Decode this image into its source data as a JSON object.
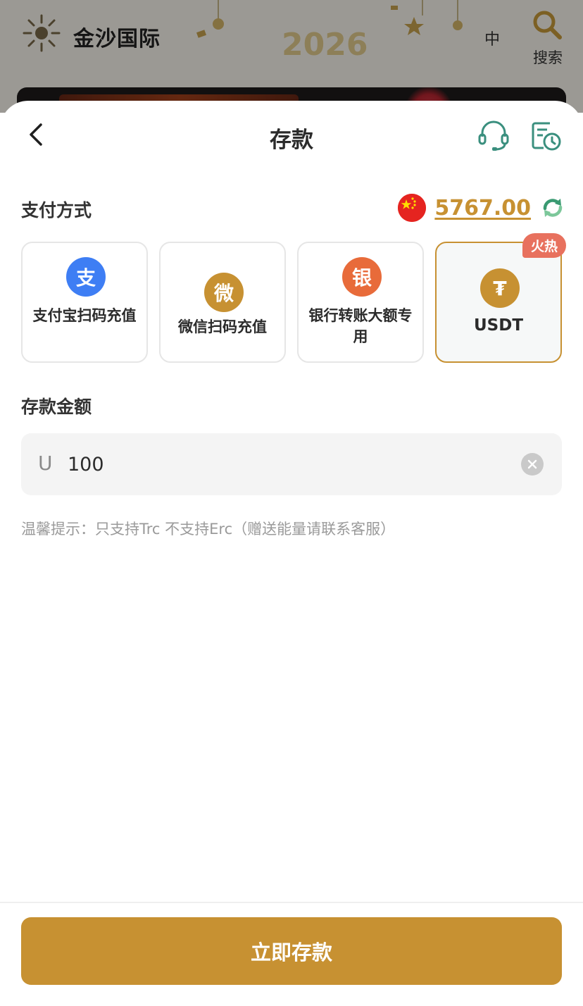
{
  "background": {
    "brand_name": "金沙国际",
    "deco_text": "2026",
    "lang_label": "中",
    "search_label": "搜索"
  },
  "sheet": {
    "title": "存款",
    "payment_section_label": "支付方式",
    "balance": "5767.00",
    "methods": [
      {
        "icon_char": "支",
        "label": "支付宝扫码充值",
        "color": "#3e7ef4",
        "selected": false
      },
      {
        "icon_char": "微",
        "label": "微信扫码充值",
        "color": "#c79132",
        "selected": false
      },
      {
        "icon_char": "银",
        "label": "银行转账大额专用",
        "color": "#e86b3a",
        "selected": false
      },
      {
        "icon_char": "₮",
        "label": "USDT",
        "color": "#c79132",
        "selected": true,
        "badge": "火热"
      }
    ],
    "amount_section_label": "存款金额",
    "amount_prefix": "U",
    "amount_value": "100",
    "hint": "温馨提示：只支持Trc 不支持Erc（赠送能量请联系客服）",
    "submit_label": "立即存款"
  },
  "colors": {
    "accent": "#c79132",
    "teal_icon": "#3a8f7e",
    "badge": "#e8715e"
  },
  "icons": [
    "back-arrow-icon",
    "customer-service-icon",
    "history-icon",
    "china-flag-icon",
    "refresh-icon",
    "clear-icon",
    "search-icon",
    "sun-logo-icon"
  ]
}
